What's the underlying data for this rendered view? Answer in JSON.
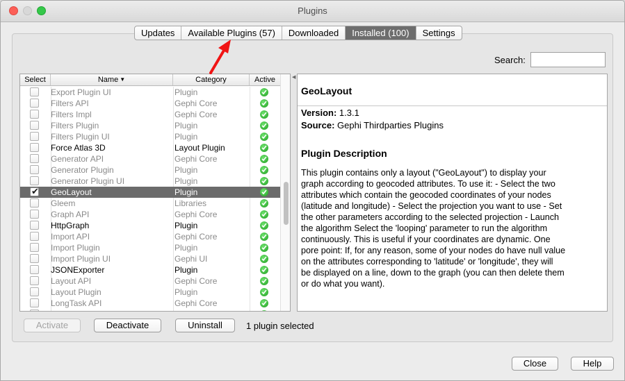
{
  "window": {
    "title": "Plugins"
  },
  "tabs": [
    {
      "label": "Updates",
      "active": false
    },
    {
      "label": "Available Plugins (57)",
      "active": false
    },
    {
      "label": "Downloaded",
      "active": false
    },
    {
      "label": "Installed (100)",
      "active": true
    },
    {
      "label": "Settings",
      "active": false
    }
  ],
  "search": {
    "label": "Search:",
    "value": ""
  },
  "table": {
    "columns": {
      "select": "Select",
      "name": "Name",
      "category": "Category",
      "active": "Active"
    },
    "rows": [
      {
        "name": "Export Plugin UI",
        "category": "Plugin",
        "enabled": false,
        "checked": false,
        "selected": false
      },
      {
        "name": "Filters API",
        "category": "Gephi Core",
        "enabled": false,
        "checked": false,
        "selected": false
      },
      {
        "name": "Filters Impl",
        "category": "Gephi Core",
        "enabled": false,
        "checked": false,
        "selected": false
      },
      {
        "name": "Filters Plugin",
        "category": "Plugin",
        "enabled": false,
        "checked": false,
        "selected": false
      },
      {
        "name": "Filters Plugin UI",
        "category": "Plugin",
        "enabled": false,
        "checked": false,
        "selected": false
      },
      {
        "name": "Force Atlas 3D",
        "category": "Layout Plugin",
        "enabled": true,
        "checked": false,
        "selected": false
      },
      {
        "name": "Generator API",
        "category": "Gephi Core",
        "enabled": false,
        "checked": false,
        "selected": false
      },
      {
        "name": "Generator Plugin",
        "category": "Plugin",
        "enabled": false,
        "checked": false,
        "selected": false
      },
      {
        "name": "Generator Plugin UI",
        "category": "Plugin",
        "enabled": false,
        "checked": false,
        "selected": false
      },
      {
        "name": "GeoLayout",
        "category": "Plugin",
        "enabled": true,
        "checked": true,
        "selected": true
      },
      {
        "name": "Gleem",
        "category": "Libraries",
        "enabled": false,
        "checked": false,
        "selected": false
      },
      {
        "name": "Graph API",
        "category": "Gephi Core",
        "enabled": false,
        "checked": false,
        "selected": false
      },
      {
        "name": "HttpGraph",
        "category": "Plugin",
        "enabled": true,
        "checked": false,
        "selected": false
      },
      {
        "name": "Import API",
        "category": "Gephi Core",
        "enabled": false,
        "checked": false,
        "selected": false
      },
      {
        "name": "Import Plugin",
        "category": "Plugin",
        "enabled": false,
        "checked": false,
        "selected": false
      },
      {
        "name": "Import Plugin UI",
        "category": "Gephi UI",
        "enabled": false,
        "checked": false,
        "selected": false
      },
      {
        "name": "JSONExporter",
        "category": "Plugin",
        "enabled": true,
        "checked": false,
        "selected": false
      },
      {
        "name": "Layout API",
        "category": "Gephi Core",
        "enabled": false,
        "checked": false,
        "selected": false
      },
      {
        "name": "Layout Plugin",
        "category": "Plugin",
        "enabled": false,
        "checked": false,
        "selected": false
      },
      {
        "name": "LongTask API",
        "category": "Gephi Core",
        "enabled": false,
        "checked": false,
        "selected": false
      },
      {
        "name": "",
        "category": "",
        "enabled": false,
        "checked": false,
        "selected": false
      }
    ]
  },
  "detail": {
    "title": "GeoLayout",
    "version_label": "Version:",
    "version": "1.3.1",
    "source_label": "Source:",
    "source": "Gephi Thirdparties Plugins",
    "description_heading": "Plugin Description",
    "description": "This plugin contains only a layout (\"GeoLayout\") to display your\ngraph according to geocoded attributes. To use it: - Select the two\nattributes which contain the geocoded coordinates of your nodes\n(latitude and longitude) - Select the projection you want to use - Set\nthe other parameters according to the selected projection - Launch\nthe algorithm Select the 'looping' parameter to run the algorithm\ncontinuously. This is useful if your coordinates are dynamic. One\npore point: If, for any reason, some of your nodes do have null value\non the attributes corresponding to 'latitude' or 'longitude', they will\nbe displayed on a line, down to the graph (you can then delete them\nor do what you want)."
  },
  "actions": {
    "activate": "Activate",
    "deactivate": "Deactivate",
    "uninstall": "Uninstall",
    "status": "1 plugin selected"
  },
  "footer": {
    "close": "Close",
    "help": "Help"
  },
  "colors": {
    "annotation_arrow": "#f01414",
    "active_tab": "#6d6d6d",
    "active_icon": "#2aa52a"
  }
}
